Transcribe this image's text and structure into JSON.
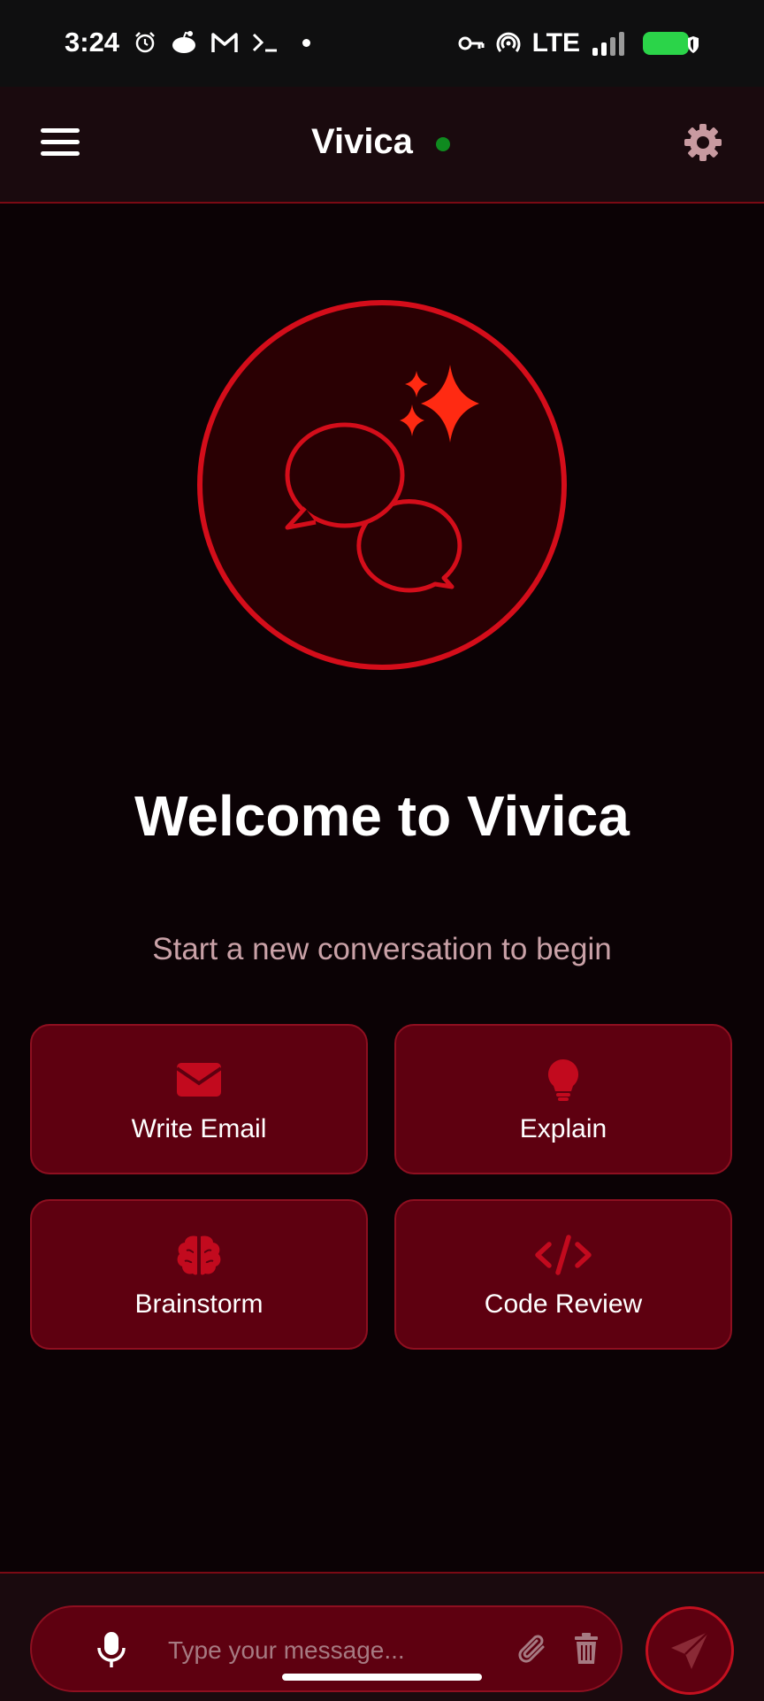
{
  "status_bar": {
    "time": "3:24",
    "network": "LTE",
    "left_icons": [
      "alarm-icon",
      "reddit-icon",
      "gmail-icon",
      "terminal-icon"
    ],
    "right_icons": [
      "vpn-key-icon",
      "hotspot-icon",
      "signal-icon",
      "battery-icon"
    ]
  },
  "header": {
    "title": "Vivica",
    "status": "online",
    "status_color": "#0f8a1f",
    "menu_icon": "hamburger-menu-icon",
    "settings_icon": "gear-icon"
  },
  "hero": {
    "icon": "chat-bubbles-sparkles-icon",
    "accent_color": "#d40d1a"
  },
  "welcome": {
    "title": "Welcome to Vivica",
    "subtitle": "Start a new conversation to begin"
  },
  "quick_actions": [
    {
      "label": "Write Email",
      "icon": "envelope-icon"
    },
    {
      "label": "Explain",
      "icon": "lightbulb-icon"
    },
    {
      "label": "Brainstorm",
      "icon": "brain-icon"
    },
    {
      "label": "Code Review",
      "icon": "code-icon"
    }
  ],
  "composer": {
    "placeholder": "Type your message...",
    "mic_icon": "microphone-icon",
    "attach_icon": "paperclip-icon",
    "clear_icon": "trash-icon",
    "send_icon": "send-icon"
  },
  "colors": {
    "background": "#0b0205",
    "card": "#5e0010",
    "card_border": "#8e0f20",
    "accent": "#c4101f"
  }
}
